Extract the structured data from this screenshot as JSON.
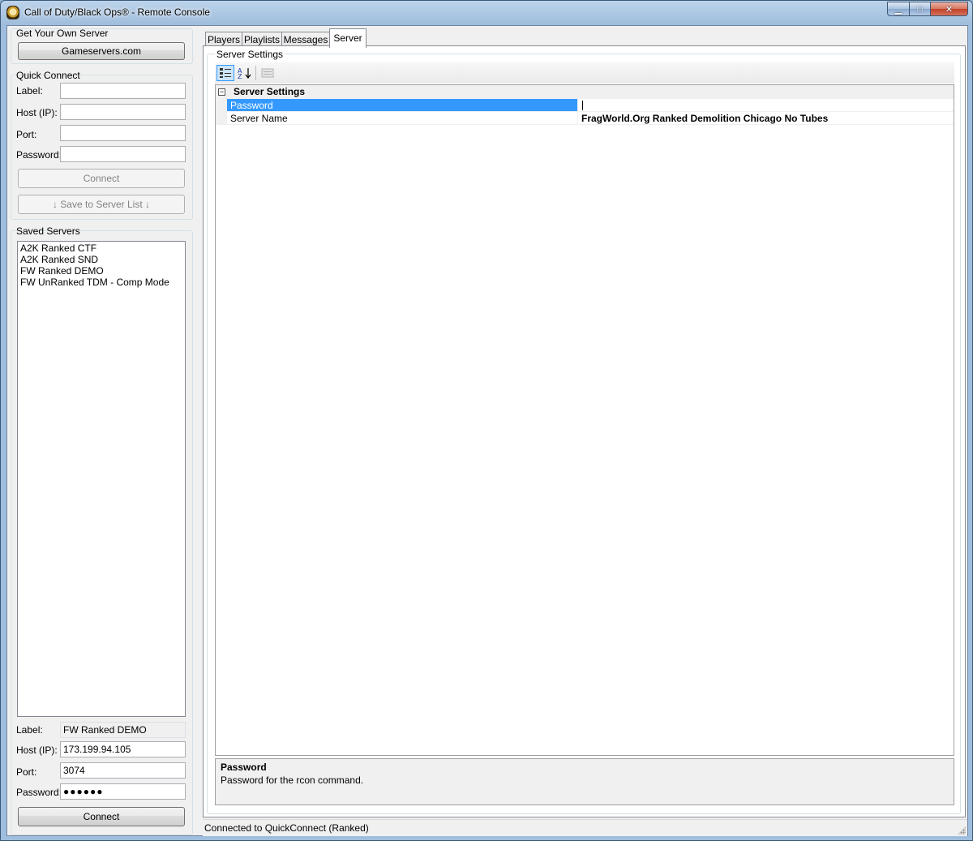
{
  "window": {
    "title": "Call of Duty/Black Ops®  - Remote Console",
    "minimize_glyph": "▁",
    "maximize_glyph": "□",
    "close_glyph": "✕"
  },
  "get_server": {
    "title": "Get Your Own Server",
    "button_label": "Gameservers.com"
  },
  "quick_connect": {
    "title": "Quick Connect",
    "label_label": "Label:",
    "host_label": "Host (IP):",
    "port_label": "Port:",
    "password_label": "Password:",
    "label_value": "",
    "host_value": "",
    "port_value": "",
    "password_value": "",
    "connect_label": "Connect",
    "save_label": "↓  Save to Server List  ↓"
  },
  "saved_servers": {
    "title": "Saved Servers",
    "items": [
      "A2K Ranked CTF",
      "A2K Ranked SND",
      "FW Ranked DEMO",
      "FW UnRanked TDM - Comp Mode"
    ]
  },
  "selected_server": {
    "label_label": "Label:",
    "host_label": "Host (IP):",
    "port_label": "Port:",
    "password_label": "Password:",
    "label_value": "FW Ranked DEMO",
    "host_value": "173.199.94.105",
    "port_value": "3074",
    "password_value": "●●●●●●",
    "connect_label": "Connect"
  },
  "tabs": [
    {
      "label": "Players",
      "active": false
    },
    {
      "label": "Playlists",
      "active": false
    },
    {
      "label": "Messages",
      "active": false
    },
    {
      "label": "Server",
      "active": true
    }
  ],
  "server_settings": {
    "group_title": "Server Settings",
    "toolbar": {
      "categorized_icon": "categorized-icon",
      "alphabetical_icon": "alphabetical-sort-icon",
      "property_pages_icon": "property-pages-icon",
      "alphabetical_glyph": "A↓Z"
    },
    "category": "Server Settings",
    "expander_glyph": "−",
    "properties": [
      {
        "name": "Password",
        "value": "",
        "selected": true
      },
      {
        "name": "Server Name",
        "value": "FragWorld.Org Ranked Demolition Chicago No Tubes",
        "selected": false
      }
    ],
    "help": {
      "title": "Password",
      "description": "Password for the rcon command."
    }
  },
  "status": {
    "text": "Connected to QuickConnect (Ranked)"
  },
  "colors": {
    "selection": "#3399ff",
    "title_gradient_top": "#bcd3ea",
    "close_button": "#c2432a"
  }
}
